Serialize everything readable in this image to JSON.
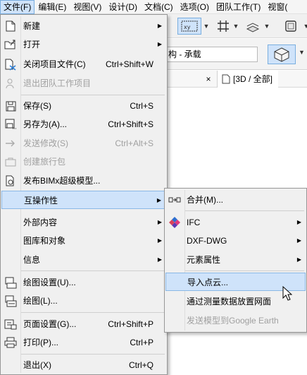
{
  "menubar": {
    "items": [
      {
        "label": "文件(F)"
      },
      {
        "label": "编辑(E)"
      },
      {
        "label": "视图(V)"
      },
      {
        "label": "设计(D)"
      },
      {
        "label": "文档(C)"
      },
      {
        "label": "选项(O)"
      },
      {
        "label": "团队工作(T)"
      },
      {
        "label": "视窗("
      }
    ]
  },
  "infobar": {
    "layer_combo": "构 - 承载"
  },
  "tabs": {
    "close": "×",
    "view_3d": "[3D / 全部]"
  },
  "file_menu": {
    "items": [
      {
        "label": "新建",
        "shortcut": "",
        "has_submenu": true
      },
      {
        "label": "打开",
        "shortcut": "",
        "has_submenu": true
      },
      {
        "label": "关闭项目文件(C)",
        "shortcut": "Ctrl+Shift+W"
      },
      {
        "label": "退出团队工作项目",
        "shortcut": "",
        "disabled": true
      },
      {
        "label": "保存(S)",
        "shortcut": "Ctrl+S"
      },
      {
        "label": "另存为(A)...",
        "shortcut": "Ctrl+Shift+S"
      },
      {
        "label": "发送修改(S)",
        "shortcut": "Ctrl+Alt+S",
        "disabled": true
      },
      {
        "label": "创建旅行包",
        "shortcut": "",
        "disabled": true
      },
      {
        "label": "发布BIMx超级模型...",
        "shortcut": ""
      },
      {
        "label": "互操作性",
        "shortcut": "",
        "has_submenu": true,
        "highlighted": true
      },
      {
        "label": "外部内容",
        "shortcut": "",
        "has_submenu": true
      },
      {
        "label": "图库和对象",
        "shortcut": "",
        "has_submenu": true
      },
      {
        "label": "信息",
        "shortcut": "",
        "has_submenu": true
      },
      {
        "label": "绘图设置(U)...",
        "shortcut": ""
      },
      {
        "label": "绘图(L)...",
        "shortcut": ""
      },
      {
        "label": "页面设置(G)...",
        "shortcut": "Ctrl+Shift+P"
      },
      {
        "label": "打印(P)...",
        "shortcut": "Ctrl+P"
      },
      {
        "label": "退出(X)",
        "shortcut": "Ctrl+Q"
      }
    ]
  },
  "interop_submenu": {
    "items": [
      {
        "label": "合并(M)..."
      },
      {
        "label": "IFC",
        "has_submenu": true
      },
      {
        "label": "DXF-DWG",
        "has_submenu": true
      },
      {
        "label": "元素属性",
        "has_submenu": true
      },
      {
        "label": "导入点云...",
        "highlighted": true
      },
      {
        "label": "通过测量数据放置网面"
      },
      {
        "label": "发送模型到Google Earth",
        "disabled": true
      }
    ]
  },
  "icons": {
    "submenu_arrow": "▶",
    "dropdown_arrow": "▼"
  },
  "colors": {
    "menu_bg": "#f0f0f0",
    "highlight_bg": "#cfe3fa",
    "highlight_border": "#7aaedf",
    "disabled_text": "#a0a0a0"
  }
}
